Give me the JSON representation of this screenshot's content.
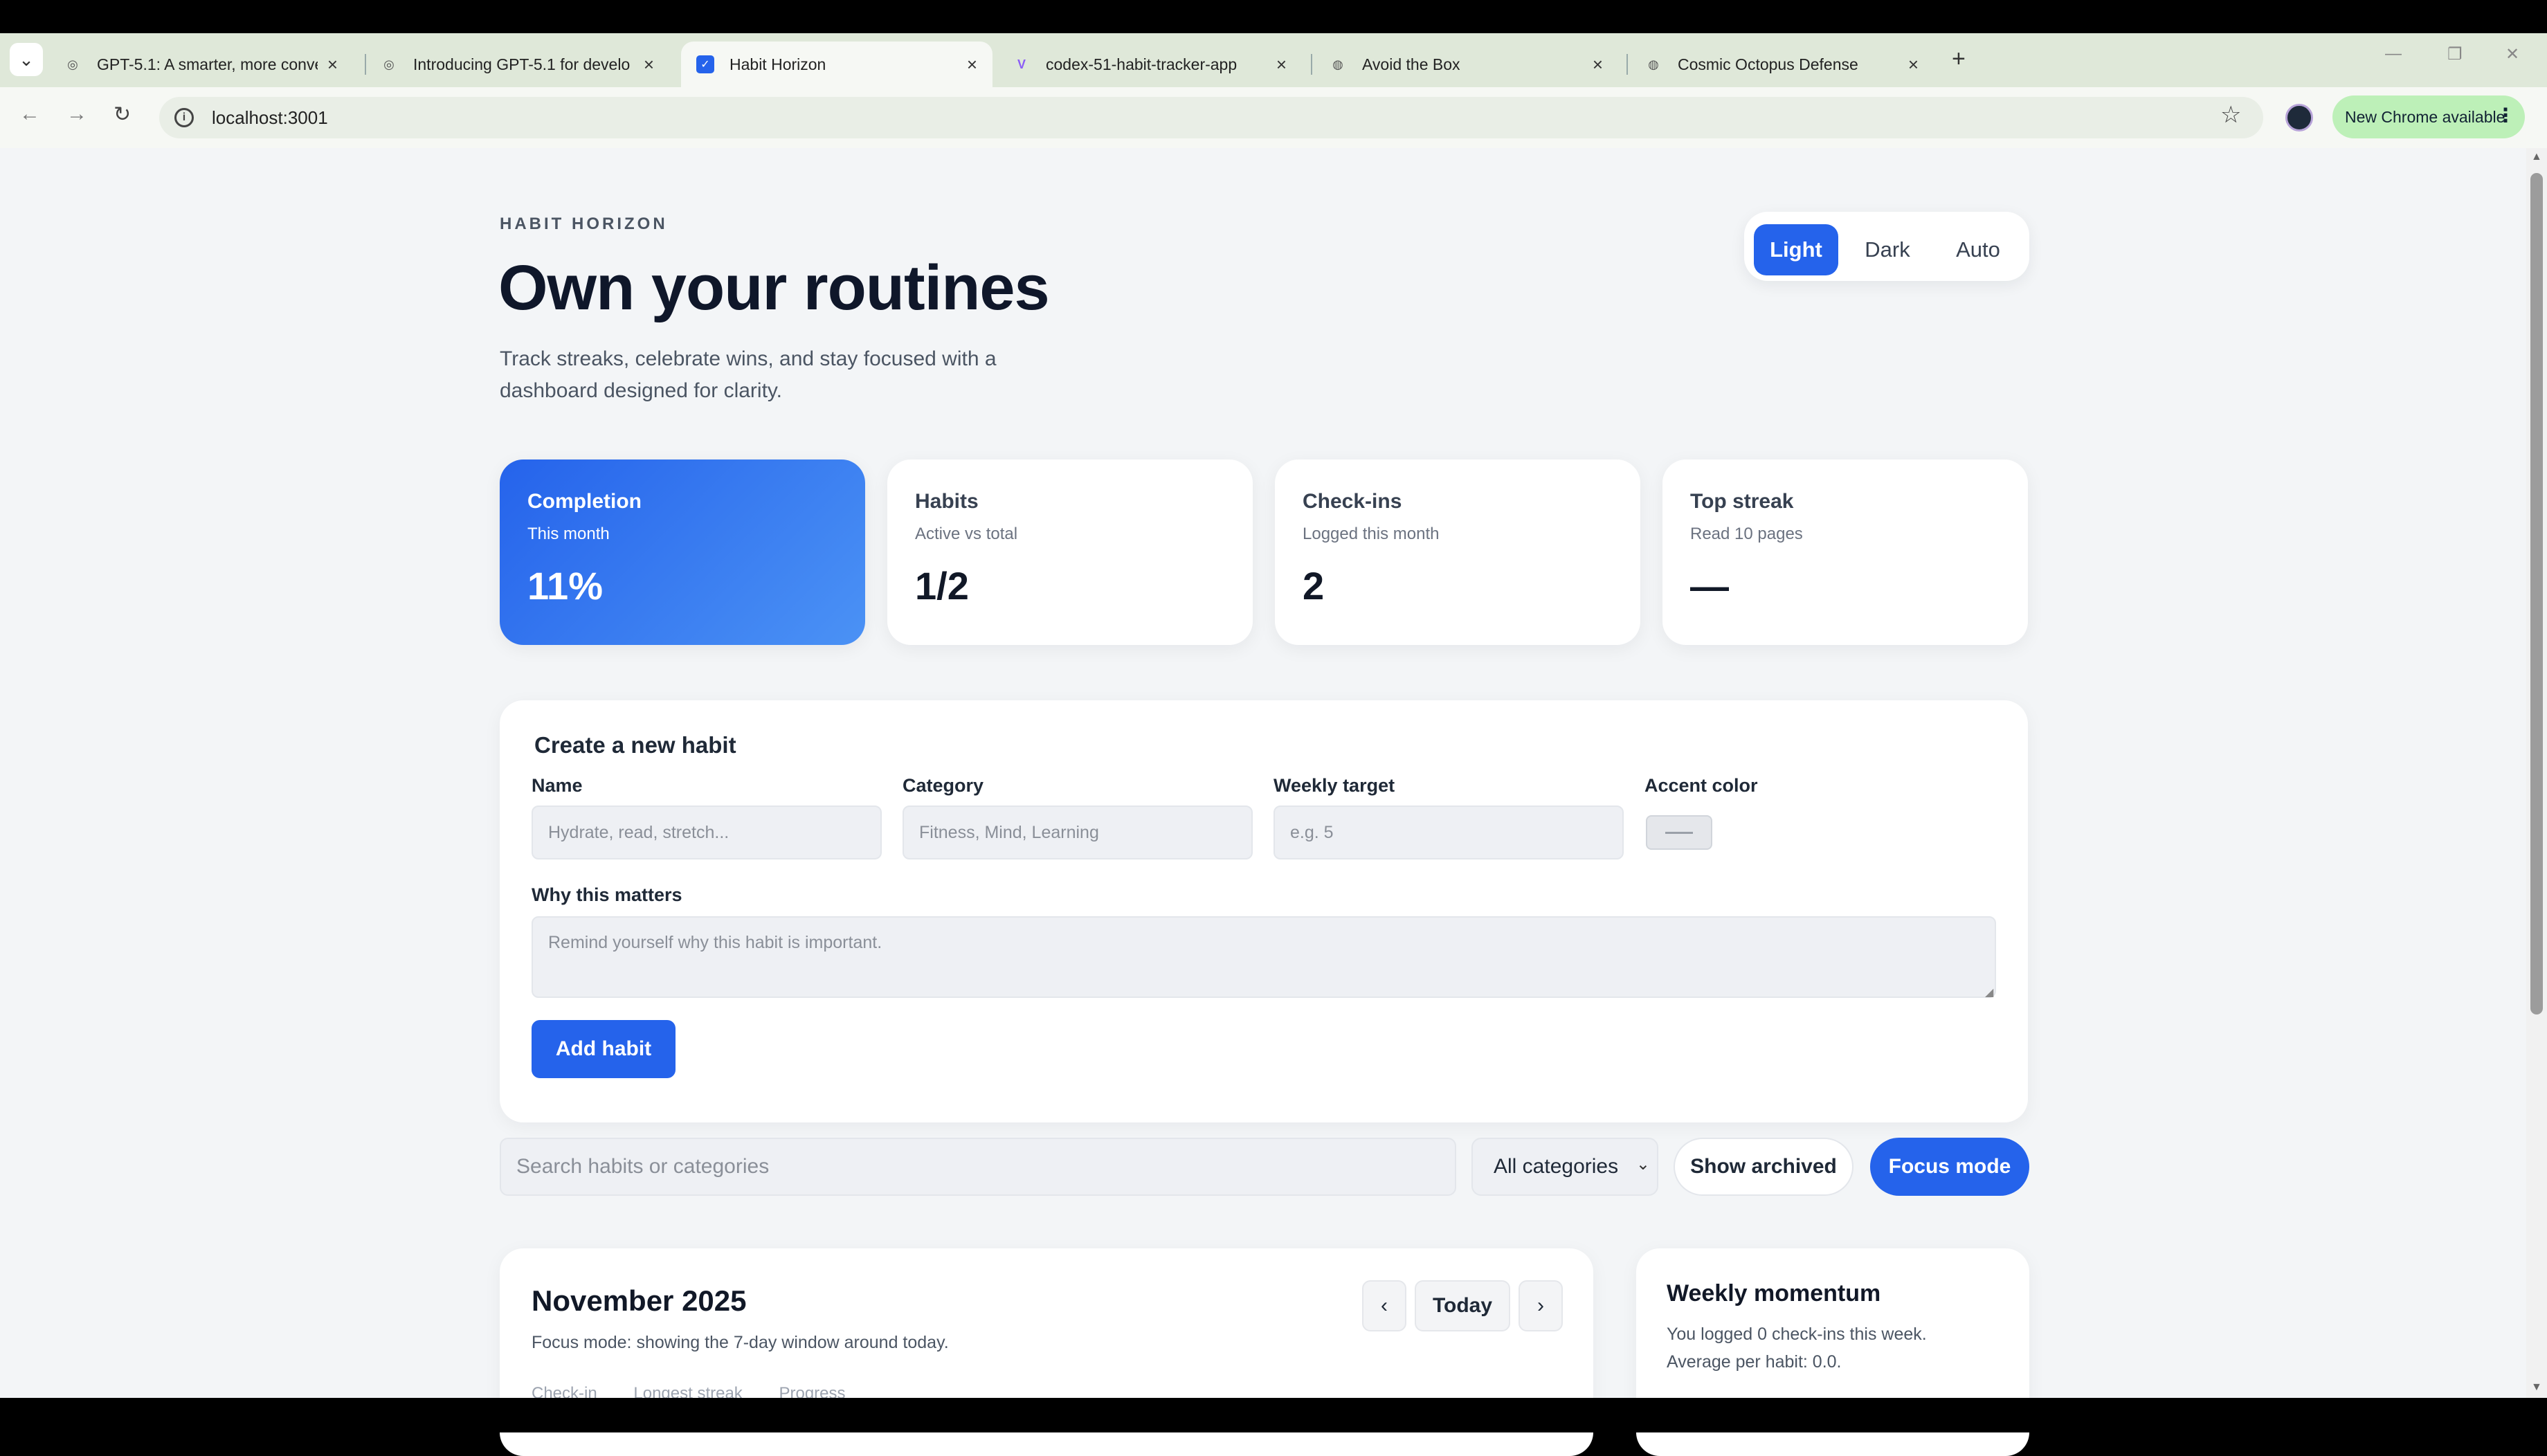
{
  "browser": {
    "tabs": [
      {
        "title": "GPT-5.1: A smarter, more conve",
        "icon": "openai-icon"
      },
      {
        "title": "Introducing GPT-5.1 for develo",
        "icon": "openai-icon"
      },
      {
        "title": "Habit Horizon",
        "icon": "checkbox-icon",
        "active": true
      },
      {
        "title": "codex-51-habit-tracker-app",
        "icon": "vite-icon"
      },
      {
        "title": "Avoid the Box",
        "icon": "globe-icon"
      },
      {
        "title": "Cosmic Octopus Defense",
        "icon": "globe-icon"
      }
    ],
    "url": "localhost:3001",
    "update_label": "New Chrome available"
  },
  "header": {
    "eyebrow": "HABIT HORIZON",
    "title": "Own your routines",
    "subtitle": "Track streaks, celebrate wins, and stay focused with a dashboard designed for clarity."
  },
  "theme": {
    "options": [
      "Light",
      "Dark",
      "Auto"
    ],
    "selected": "Light"
  },
  "stats": [
    {
      "label": "Completion",
      "sub": "This month",
      "value": "11%"
    },
    {
      "label": "Habits",
      "sub": "Active vs total",
      "value": "1/2"
    },
    {
      "label": "Check-ins",
      "sub": "Logged this month",
      "value": "2"
    },
    {
      "label": "Top streak",
      "sub": "Read 10 pages",
      "value": "—"
    }
  ],
  "form": {
    "title": "Create a new habit",
    "name_label": "Name",
    "name_placeholder": "Hydrate, read, stretch...",
    "category_label": "Category",
    "category_placeholder": "Fitness, Mind, Learning",
    "target_label": "Weekly target",
    "target_placeholder": "e.g. 5",
    "color_label": "Accent color",
    "why_label": "Why this matters",
    "why_placeholder": "Remind yourself why this habit is important.",
    "submit_label": "Add habit"
  },
  "filters": {
    "search_placeholder": "Search habits or categories",
    "category_selected": "All categories",
    "archived_label": "Show archived",
    "focus_label": "Focus mode"
  },
  "calendar": {
    "month": "November 2025",
    "prev_label": "‹",
    "today_label": "Today",
    "next_label": "›",
    "focus_note": "Focus mode: showing the 7-day window around today.",
    "columns": [
      "Check-in",
      "Longest streak",
      "Progress"
    ]
  },
  "momentum": {
    "title": "Weekly momentum",
    "line1": "You logged 0 check-ins this week.",
    "line2": "Average per habit: 0.0."
  },
  "colors": {
    "accent": "#2563eb",
    "background": "#f3f5f7",
    "tabstrip": "#dfe8d9",
    "update_pill": "#bdf0b8"
  }
}
